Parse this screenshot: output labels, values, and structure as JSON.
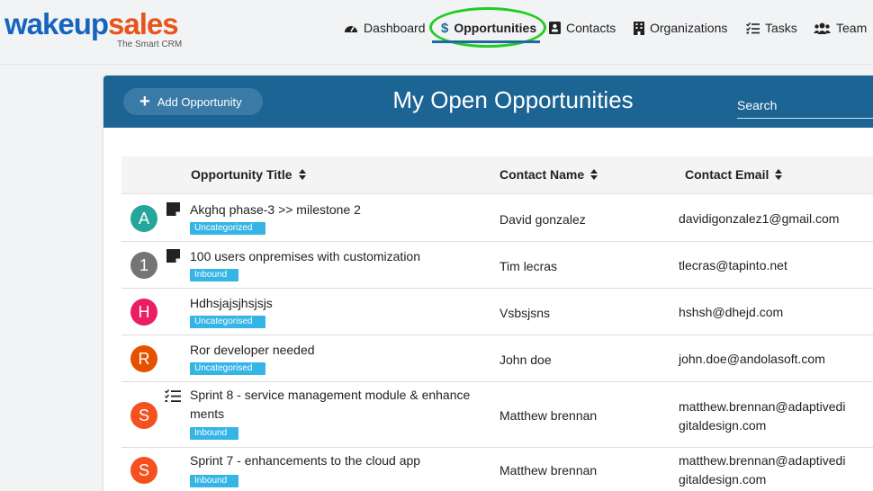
{
  "brand": {
    "part1": "wakeup",
    "part2": "sales",
    "tagline": "The Smart CRM",
    "color_blue": "#1565c0",
    "color_orange": "#e8541a"
  },
  "nav": {
    "items": [
      {
        "label": "Dashboard",
        "icon": "dashboard-gauge-icon"
      },
      {
        "label": "Opportunities",
        "icon": "dollar-icon",
        "active": true
      },
      {
        "label": "Contacts",
        "icon": "contact-card-icon"
      },
      {
        "label": "Organizations",
        "icon": "building-icon"
      },
      {
        "label": "Tasks",
        "icon": "tasks-checklist-icon"
      },
      {
        "label": "Team",
        "icon": "team-users-icon"
      }
    ],
    "highlight_color": "#22cc22"
  },
  "page": {
    "add_button_label": "Add Opportunity",
    "title": "My Open Opportunities",
    "search_placeholder": "Search",
    "header_color": "#1b6494"
  },
  "table": {
    "columns": [
      "Opportunity Title",
      "Contact Name",
      "Contact Email"
    ],
    "rows": [
      {
        "avatar": "A",
        "avatar_color": "#26a69a",
        "icon": "note-icon",
        "title": "Akghq phase-3 >> milestone 2",
        "badge": "Uncategorized",
        "contact": "David gonzalez",
        "email": "davidigonzalez1@gmail.com"
      },
      {
        "avatar": "1",
        "avatar_color": "#757575",
        "icon": "note-icon",
        "title": "100 users onpremises with customization",
        "badge": "Inbound",
        "contact": "Tim lecras",
        "email": "tlecras@tapinto.net"
      },
      {
        "avatar": "H",
        "avatar_color": "#e91e63",
        "icon": "",
        "title": "Hdhsjajsjhsjsjs",
        "badge": "Uncategorised",
        "contact": "Vsbsjsns",
        "email": "hshsh@dhejd.com"
      },
      {
        "avatar": "R",
        "avatar_color": "#e65100",
        "icon": "",
        "title": "Ror developer needed",
        "badge": "Uncategorised",
        "contact": "John doe",
        "email": "john.doe@andolasoft.com"
      },
      {
        "avatar": "S",
        "avatar_color": "#f4511e",
        "icon": "tasks-icon",
        "title": "Sprint 8 - service management module & enhance ments",
        "badge": "Inbound",
        "contact": "Matthew brennan",
        "email": "matthew.brennan@adaptivedi gitaldesign.com"
      },
      {
        "avatar": "S",
        "avatar_color": "#f4511e",
        "icon": "",
        "title": "Sprint 7 - enhancements to the cloud app",
        "badge": "Inbound",
        "contact": "Matthew brennan",
        "email": "matthew.brennan@adaptivedi gitaldesign.com"
      }
    ]
  }
}
